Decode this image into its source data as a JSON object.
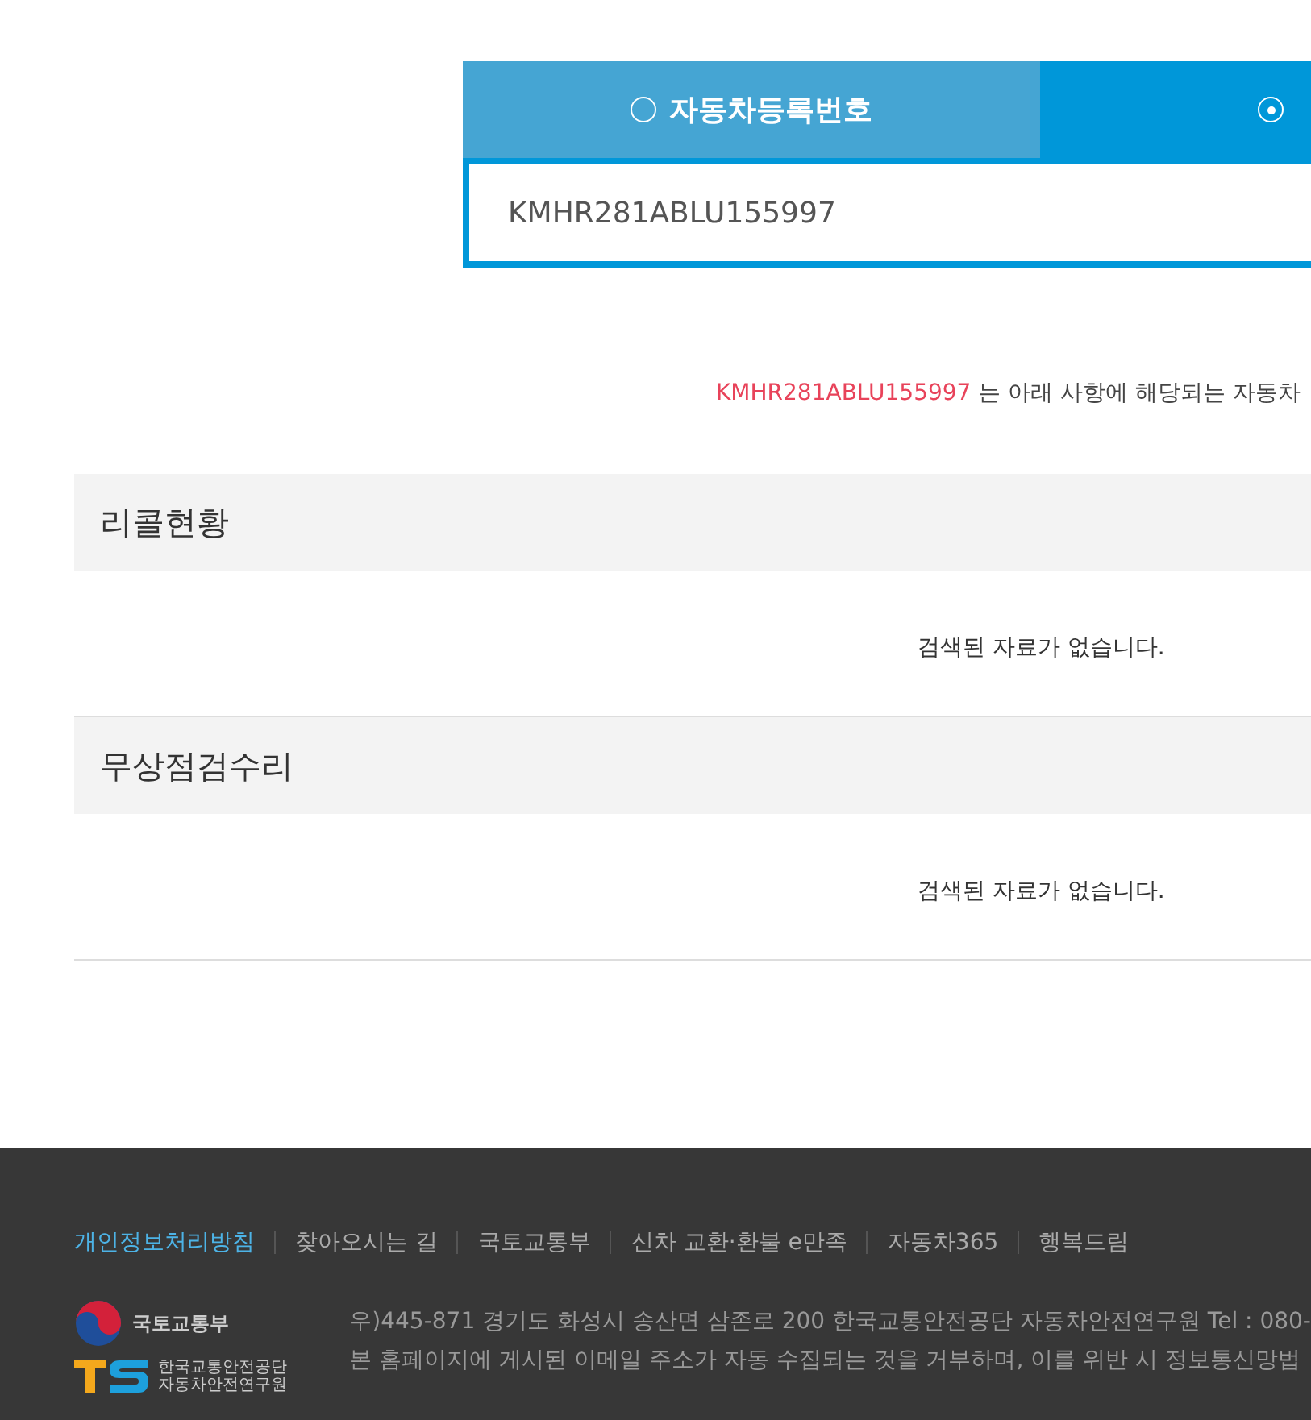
{
  "search_tabs": [
    {
      "label": "자동차등록번호",
      "selected": false
    },
    {
      "selected": true
    }
  ],
  "search_field": {
    "value": "KMHR281ABLU155997"
  },
  "result_notice": {
    "vin": "KMHR281ABLU155997",
    "text": "는 아래 사항에 해당되는 자동차"
  },
  "sections": [
    {
      "title": "리콜현황",
      "message": "검색된 자료가 없습니다."
    },
    {
      "title": "무상점검수리",
      "message": "검색된 자료가 없습니다."
    }
  ],
  "footer": {
    "links": [
      {
        "label": "개인정보처리방침",
        "highlighted": true
      },
      {
        "label": "찾아오시는 길",
        "highlighted": false
      },
      {
        "label": "국토교통부",
        "highlighted": false
      },
      {
        "label": "신차 교환·환불 e만족",
        "highlighted": false
      },
      {
        "label": "자동차365",
        "highlighted": false
      },
      {
        "label": "행복드림",
        "highlighted": false
      }
    ],
    "ministry_logo": "국토교통부",
    "ts_logo_lines": [
      "한국교통안전공단",
      "자동차안전연구원"
    ],
    "address_lines": [
      "우)445-871 경기도 화성시 송산면 삼존로 200 한국교통안전공단 자동차안전연구원 Tel : 080-",
      "본 홈페이지에 게시된 이메일 주소가 자동 수집되는 것을 거부하며, 이를 위반 시 정보통신망법"
    ]
  }
}
